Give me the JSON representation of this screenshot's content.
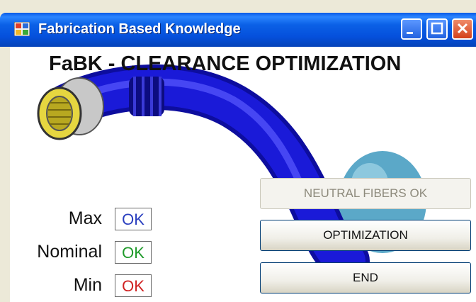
{
  "window": {
    "title": "Fabrication Based Knowledge"
  },
  "main": {
    "heading": "FaBK - CLEARANCE OPTIMIZATION"
  },
  "status_rows": [
    {
      "label": "Max",
      "value": "OK",
      "color": "#2a3fbf"
    },
    {
      "label": "Nominal",
      "value": "OK",
      "color": "#1f9a2a"
    },
    {
      "label": "Min",
      "value": "OK",
      "color": "#d02222"
    }
  ],
  "buttons": {
    "neutral_fibers": "NEUTRAL FIBERS OK",
    "optimization": "OPTIMIZATION",
    "end": "END"
  },
  "colors": {
    "hose": "#1010cc",
    "connector": "#e6d640",
    "titlebar": "#0b61e6"
  }
}
